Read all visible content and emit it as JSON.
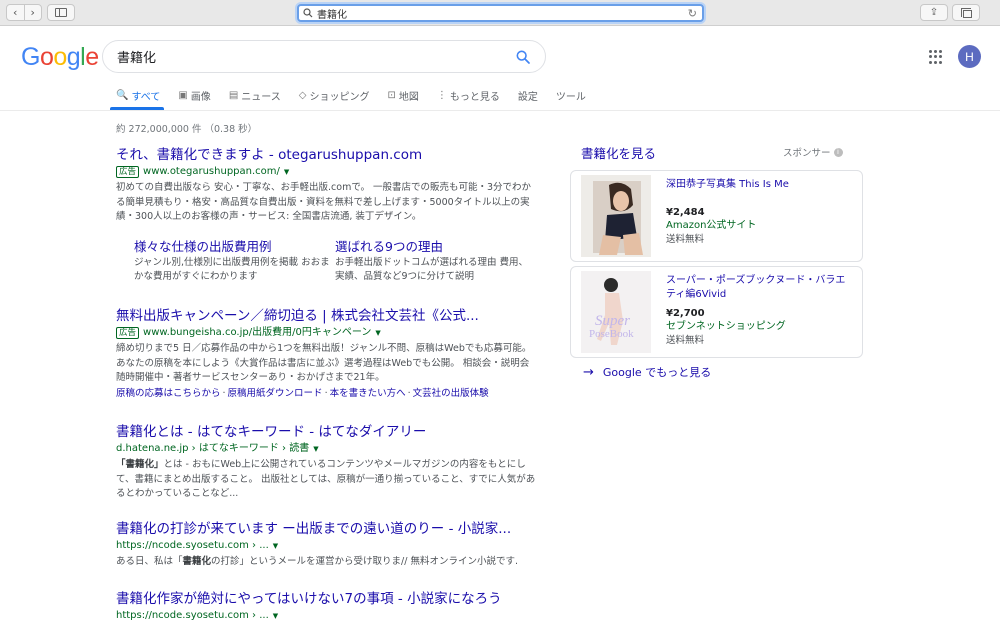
{
  "browser": {
    "address": "書籍化",
    "back_glyph": "‹",
    "forward_glyph": "›",
    "reload_glyph": "↻",
    "share_glyph": "⇪"
  },
  "google": {
    "logo_letters": [
      {
        "ch": "G",
        "color": "#4285F4"
      },
      {
        "ch": "o",
        "color": "#EA4335"
      },
      {
        "ch": "o",
        "color": "#FBBC05"
      },
      {
        "ch": "g",
        "color": "#4285F4"
      },
      {
        "ch": "l",
        "color": "#34A853"
      },
      {
        "ch": "e",
        "color": "#EA4335"
      }
    ],
    "query": "書籍化",
    "avatar_letter": "H"
  },
  "tabs": [
    {
      "label": "すべて",
      "icon": "search-icon",
      "glyph": "🔍",
      "active": true
    },
    {
      "label": "画像",
      "icon": "image-icon",
      "glyph": "▣"
    },
    {
      "label": "ニュース",
      "icon": "news-icon",
      "glyph": "▤"
    },
    {
      "label": "ショッピング",
      "icon": "tag-icon",
      "glyph": "◇"
    },
    {
      "label": "地図",
      "icon": "map-icon",
      "glyph": "⊡"
    },
    {
      "label": "もっと見る",
      "icon": "more-icon",
      "glyph": "⋮"
    },
    {
      "label": "設定"
    },
    {
      "label": "ツール"
    }
  ],
  "stats": "約 272,000,000 件 （0.38 秒）",
  "results": [
    {
      "title": "それ、書籍化できますよ - otegarushuppan.com",
      "ad": "広告",
      "url": "www.otegarushuppan.com/",
      "desc": "初めての自費出版なら 安心・丁寧な、お手軽出版.comで。 一般書店での販売も可能・3分でわかる簡単見積もり・格安・高品質な自費出版・資料を無料で差し上げます・5000タイトル以上の実績・300人以上のお客様の声・サービス: 全国書店流通, 装丁デザイン。",
      "sitelinks": [
        {
          "title": "様々な仕様の出版費用例",
          "desc": "ジャンル別,仕様別に出版費用例を掲載 おおまかな費用がすぐにわかります"
        },
        {
          "title": "選ばれる9つの理由",
          "desc": "お手軽出版ドットコムが選ばれる理由 費用、実績、品質など9つに分けて説明"
        }
      ]
    },
    {
      "title": "無料出版キャンペーン／締切迫る | 株式会社文芸社《公式...",
      "ad": "広告",
      "url": "www.bungeisha.co.jp/出版費用/0円キャンペーン",
      "desc": "締め切りまで5 日／応募作品の中から1つを無料出版！ジャンル不問、原稿はWebでも応募可能。 あなたの原稿を本にしよう《大賞作品は書店に並ぶ》選考過程はWebでも公開。 相談会・説明会随時開催中・著者サービスセンターあり・おかげさまで21年。",
      "links": [
        "原稿の応募はこちらから",
        "原稿用紙ダウンロード",
        "本を書きたい方へ",
        "文芸社の出版体験"
      ]
    },
    {
      "title": "書籍化とは - はてなキーワード - はてなダイアリー",
      "url": "d.hatena.ne.jp › はてなキーワード › 読書",
      "desc_bold": "「書籍化」",
      "desc": "とは - おもにWeb上に公開されているコンテンツやメールマガジンの内容をもとにして、書籍にまとめ出版すること。 出版社としては、原稿が一通り揃っていること、すでに人気があるとわかっていることなど..."
    },
    {
      "title": "書籍化の打診が来ています ー出版までの遠い道のりー - 小説家...",
      "url": "https://ncode.syosetu.com › ...",
      "desc_pre": "ある日、私は「",
      "desc_bold": "書籍化",
      "desc": "の打診」というメールを運営から受け取りま// 無料オンライン小説です."
    },
    {
      "title": "書籍化作家が絶対にやってはいけない7の事項 - 小説家になろう",
      "url": "https://ncode.syosetu.com › ..."
    }
  ],
  "shopping": {
    "heading": "書籍化を見る",
    "sponsor": "スポンサー",
    "items": [
      {
        "title": "深田恭子写真集 This Is Me",
        "price": "¥2,484",
        "store": "Amazon公式サイト",
        "shipping": "送料無料"
      },
      {
        "title": "スーパー・ポーズブックヌード・バラエティ編6Vivid",
        "price": "¥2,700",
        "store": "セブンネットショッピング",
        "shipping": "送料無料"
      }
    ],
    "more": "Google でもっと見る",
    "more_arrow": "→"
  }
}
